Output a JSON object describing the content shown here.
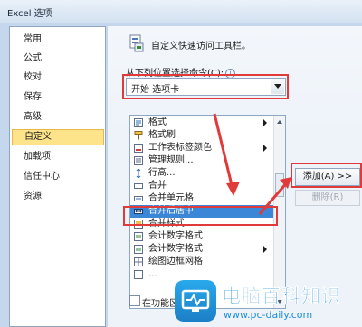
{
  "window": {
    "title": "Excel 选项"
  },
  "sidebar": {
    "items": [
      {
        "label": "常用"
      },
      {
        "label": "公式"
      },
      {
        "label": "校对"
      },
      {
        "label": "保存"
      },
      {
        "label": "高级"
      },
      {
        "label": "自定义",
        "selected": true
      },
      {
        "label": "加载项"
      },
      {
        "label": "信任中心"
      },
      {
        "label": "资源"
      }
    ]
  },
  "main": {
    "heading": "自定义快速访问工具栏。",
    "choose_label": "从下列位置选择命令(C):",
    "dropdown_value": "开始 选项卡",
    "commands": [
      {
        "label": "格式",
        "icon": "format-icon",
        "submenu": true
      },
      {
        "label": "格式刷",
        "icon": "format-painter-icon"
      },
      {
        "label": "工作表标签颜色",
        "icon": "tab-color-icon",
        "submenu": true
      },
      {
        "label": "管理规则...",
        "icon": "manage-rules-icon"
      },
      {
        "label": "行高...",
        "icon": "row-height-icon"
      },
      {
        "label": "合并",
        "icon": "merge-icon"
      },
      {
        "label": "合并单元格",
        "icon": "merge-cells-icon"
      },
      {
        "label": "合并后居中",
        "icon": "merge-center-icon",
        "selected": true
      },
      {
        "label": "合并样式...",
        "icon": "merge-styles-icon"
      },
      {
        "label": "会计数字格式",
        "icon": "accounting-format-icon"
      },
      {
        "label": "会计数字格式",
        "icon": "accounting-format-icon",
        "submenu": true
      },
      {
        "label": "绘图边框网格",
        "icon": "draw-border-grid-icon"
      },
      {
        "label": "...",
        "icon": "more-icon"
      }
    ],
    "add_button": "添加(A) >>",
    "remove_button": "删除(R)",
    "checkbox_label": "在功能区",
    "accent_color": "#e03a3a"
  },
  "watermark": {
    "title": "电脑百科知识",
    "url": "www.pc-daily.com"
  }
}
